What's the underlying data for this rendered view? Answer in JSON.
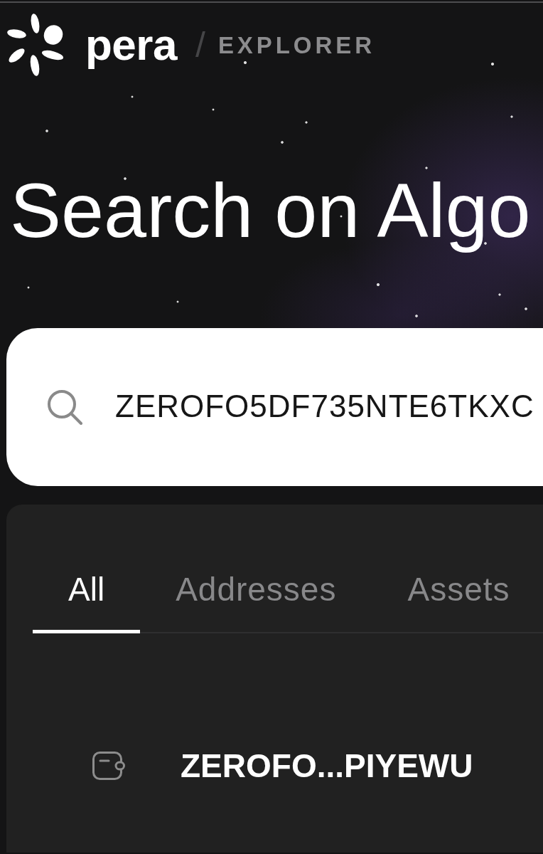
{
  "header": {
    "brand": "pera",
    "separator": "/",
    "product": "EXPLORER"
  },
  "hero": {
    "title": "Search on Algo"
  },
  "search": {
    "value": "ZEROFO5DF735NTE6TKXC"
  },
  "results": {
    "tabs": [
      {
        "label": "All",
        "selected": true
      },
      {
        "label": "Addresses",
        "selected": false
      },
      {
        "label": "Assets",
        "selected": false
      }
    ],
    "items": [
      {
        "kind": "address",
        "label": "ZEROFO...PIYEWU"
      }
    ]
  }
}
